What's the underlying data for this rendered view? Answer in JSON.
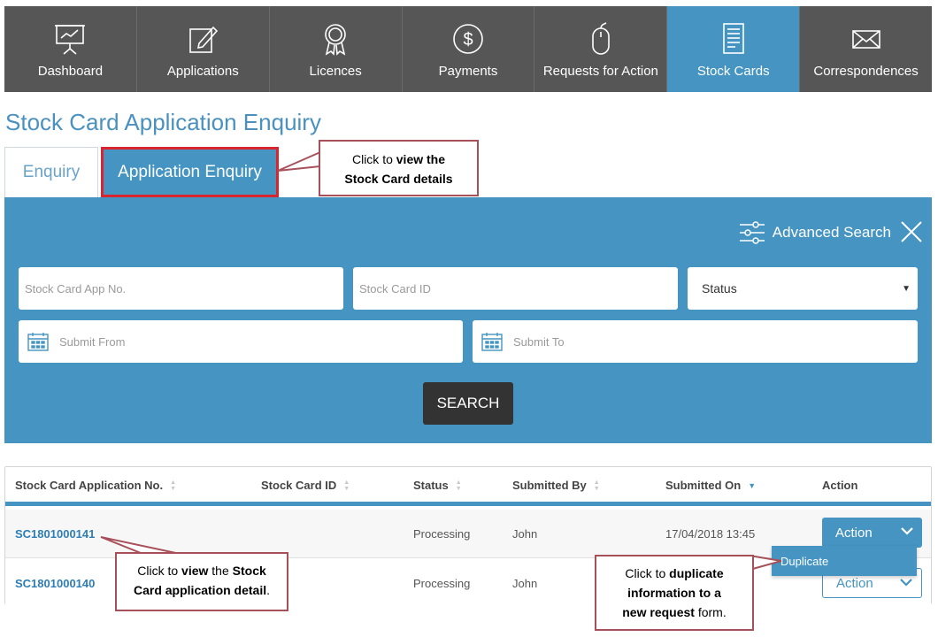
{
  "nav": {
    "items": [
      {
        "label": "Dashboard",
        "icon": "presentation-board-icon"
      },
      {
        "label": "Applications",
        "icon": "edit-document-icon"
      },
      {
        "label": "Licences",
        "icon": "award-ribbon-icon"
      },
      {
        "label": "Payments",
        "icon": "dollar-coin-icon"
      },
      {
        "label": "Requests for Action",
        "icon": "mouse-icon"
      },
      {
        "label": "Stock Cards",
        "icon": "document-list-icon"
      },
      {
        "label": "Correspondences",
        "icon": "envelope-icon"
      }
    ],
    "active": "Stock Cards",
    "active_color": "#4594c2",
    "bg_color": "#565656"
  },
  "page": {
    "title": "Stock Card Application Enquiry"
  },
  "tabs": {
    "enquiry": "Enquiry",
    "application_enquiry": "Application Enquiry"
  },
  "callouts": {
    "tab_callout": {
      "pre": "Click to ",
      "bold1": "view the",
      "bold2": "Stock Card details"
    },
    "row_callout": {
      "pre": "Click to ",
      "bold1": "view",
      "mid": " the ",
      "bold2": "Stock",
      "bold3": "Card application detail",
      "post": "."
    },
    "dup_callout": {
      "pre": "Click to ",
      "bold1": "duplicate",
      "bold2": "information to a",
      "bold3": "new request",
      "post": " form."
    }
  },
  "search": {
    "advanced_label": "Advanced Search",
    "app_no_placeholder": "Stock Card App No.",
    "card_id_placeholder": "Stock Card ID",
    "status_value": "Status",
    "submit_from_placeholder": "Submit From",
    "submit_to_placeholder": "Submit To",
    "search_button": "SEARCH"
  },
  "table": {
    "columns": [
      "Stock Card Application No.",
      "Stock Card ID",
      "Status",
      "Submitted By",
      "Submitted On",
      "Action"
    ],
    "rows": [
      {
        "app_no": "SC1801000141",
        "card_id": "",
        "status": "Processing",
        "submitted_by": "John",
        "submitted_on": "17/04/2018 13:45",
        "action": "Action"
      },
      {
        "app_no": "SC1801000140",
        "card_id": "",
        "status": "Processing",
        "submitted_by": "John",
        "submitted_on": "",
        "action": "Action"
      }
    ],
    "dropdown_item": "Duplicate"
  }
}
